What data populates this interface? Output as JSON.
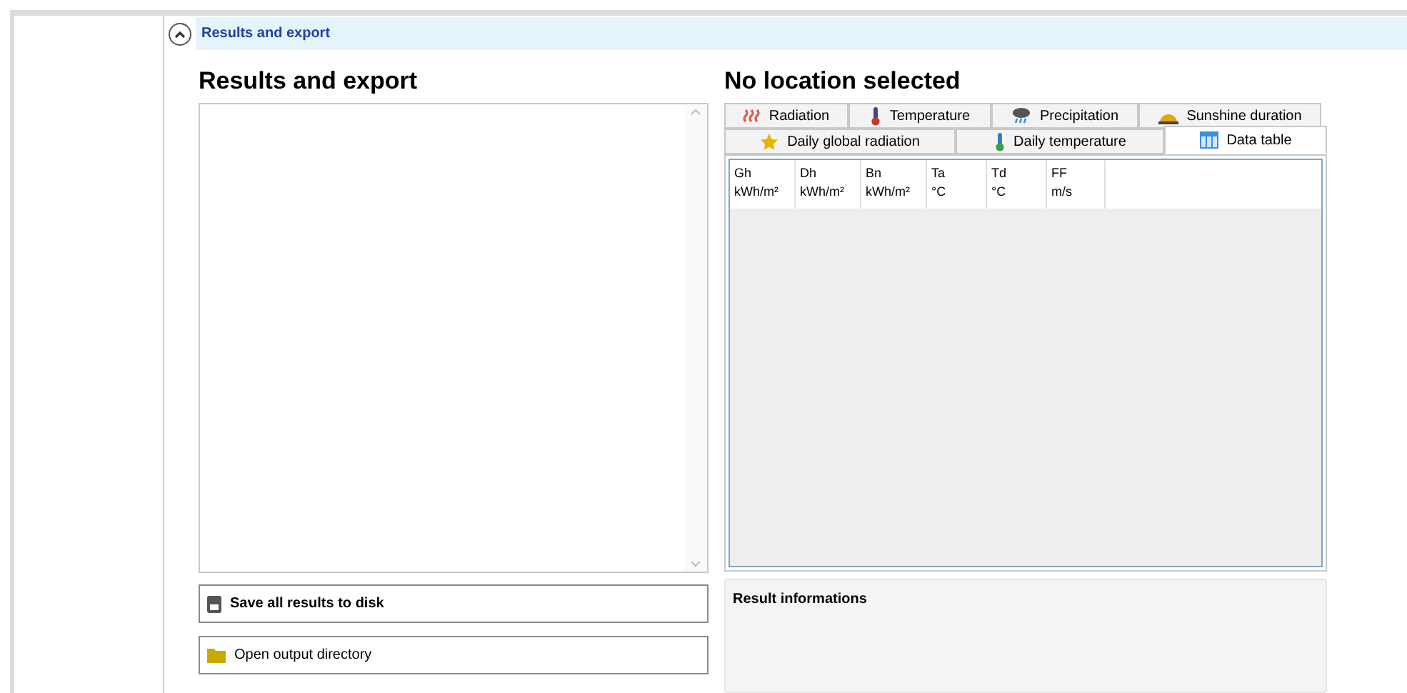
{
  "section_header": {
    "title": "Results and export",
    "expanded": true
  },
  "left_panel": {
    "title": "Results and export",
    "buttons": [
      {
        "label": "Save all results to disk",
        "bold": true
      },
      {
        "label": "Open output directory",
        "bold": false
      }
    ]
  },
  "right_panel": {
    "title": "No location selected",
    "tab_rows": [
      [
        {
          "label": "Radiation",
          "selected": false
        },
        {
          "label": "Temperature",
          "selected": false
        },
        {
          "label": "Precipitation",
          "selected": false
        },
        {
          "label": "Sunshine duration",
          "selected": false
        }
      ],
      [
        {
          "label": "Daily global radiation",
          "selected": false
        },
        {
          "label": "Daily temperature",
          "selected": false
        },
        {
          "label": "Data table",
          "selected": true
        }
      ]
    ],
    "table": {
      "columns": [
        {
          "name": "Gh",
          "unit": "kWh/m²"
        },
        {
          "name": "Dh",
          "unit": "kWh/m²"
        },
        {
          "name": "Bn",
          "unit": "kWh/m²"
        },
        {
          "name": "Ta",
          "unit": "°C"
        },
        {
          "name": "Td",
          "unit": "°C"
        },
        {
          "name": "FF",
          "unit": "m/s"
        }
      ]
    },
    "result_group": {
      "title": "Result informations"
    }
  }
}
